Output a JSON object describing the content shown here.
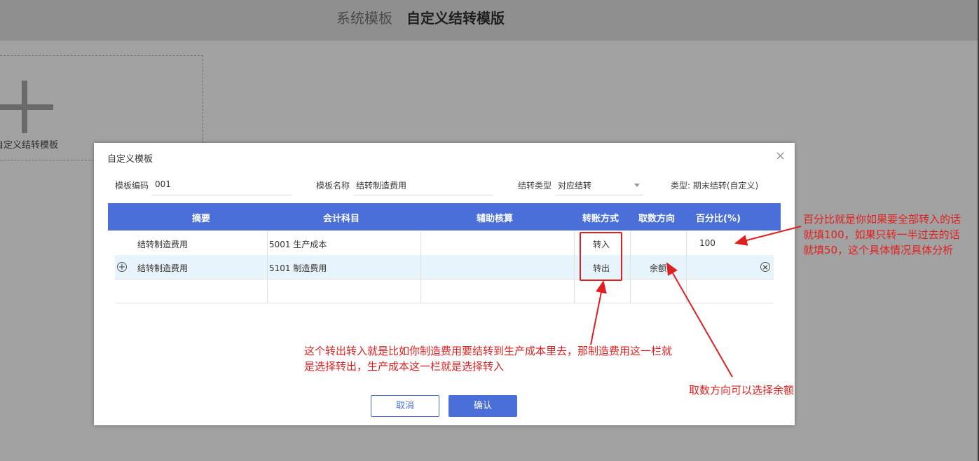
{
  "header": {
    "tabs": [
      {
        "label": "系统模板"
      },
      {
        "label": "自定义结转模版"
      }
    ]
  },
  "template_list": {
    "new_card_label": "自定义结转模板"
  },
  "dialog": {
    "title": "自定义模板",
    "close_icon": "×",
    "fields": {
      "code_label": "模板编码",
      "code_value": "001",
      "name_label": "模板名称",
      "name_value": "结转制造费用",
      "type_label": "结转类型",
      "type_value": "对应结转",
      "kind_text": "类型: 期末结转(自定义)"
    },
    "table": {
      "headers": [
        "摘要",
        "会计科目",
        "辅助核算",
        "转账方式",
        "取数方向",
        "百分比(%)"
      ],
      "rows": [
        {
          "summary": "结转制造费用",
          "account": "5001 生产成本",
          "aux": "",
          "method": "转入",
          "direction": "",
          "percent": "100"
        },
        {
          "summary": "结转制造费用",
          "account": "5101 制造费用",
          "aux": "",
          "method": "转出",
          "direction": "余额",
          "percent": ""
        },
        {
          "summary": "",
          "account": "",
          "aux": "",
          "method": "",
          "direction": "",
          "percent": ""
        }
      ]
    },
    "buttons": {
      "cancel": "取消",
      "ok": "确认"
    }
  },
  "annotations": {
    "percent_note_line1": "百分比就是你如果要全部转入的话",
    "percent_note_line2": "就填100，如果只转一半过去的话",
    "percent_note_line3": "就填50，这个具体情况具体分析",
    "method_note_line1": "这个转出转入就是比如你制造费用要结转到生产成本里去，那制造费用这一栏就",
    "method_note_line2": "是选择转出，生产成本这一栏就是选择转入",
    "direction_note": "取数方向可以选择余额",
    "color": "#e02020"
  }
}
